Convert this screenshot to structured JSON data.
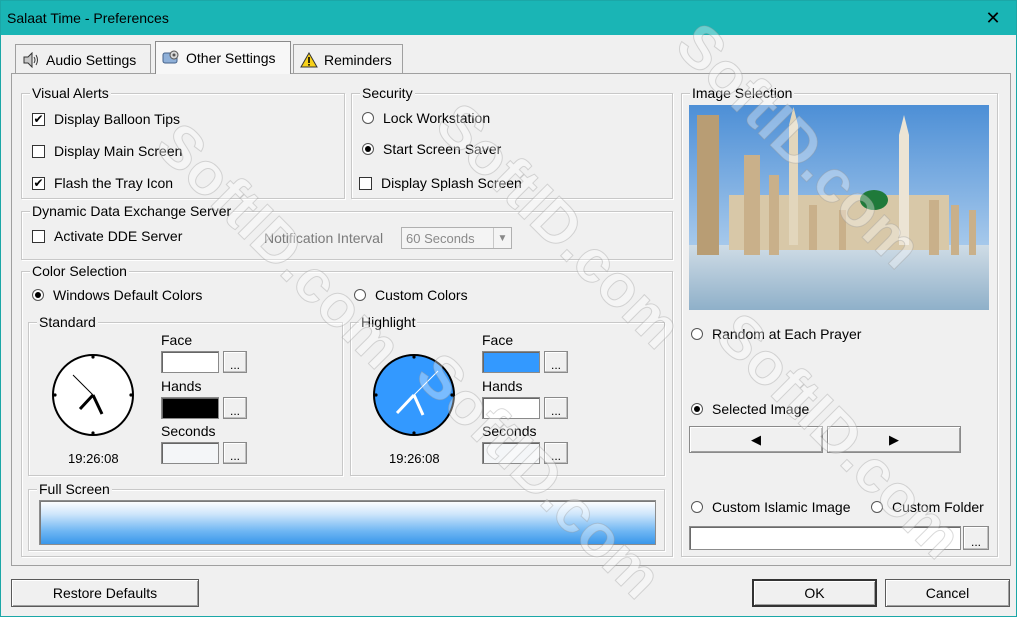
{
  "window": {
    "title": "Salaat Time - Preferences",
    "close_glyph": "✕"
  },
  "tabs": [
    {
      "label": "Audio Settings",
      "icon": "speaker-icon"
    },
    {
      "label": "Other Settings",
      "icon": "gear-icon"
    },
    {
      "label": "Reminders",
      "icon": "warning-icon"
    }
  ],
  "visual_alerts": {
    "title": "Visual Alerts",
    "items": [
      {
        "label": "Display Balloon Tips",
        "checked": true
      },
      {
        "label": "Display Main Screen",
        "checked": false
      },
      {
        "label": "Flash the Tray Icon",
        "checked": true
      }
    ]
  },
  "security": {
    "title": "Security",
    "lock": {
      "label": "Lock Workstation",
      "selected": false
    },
    "saver": {
      "label": "Start Screen Saver",
      "selected": true
    },
    "splash": {
      "label": "Display Splash Screen",
      "checked": false
    }
  },
  "dde": {
    "title": "Dynamic Data Exchange Server",
    "activate": {
      "label": "Activate DDE Server",
      "checked": false
    },
    "interval_label": "Notification Interval",
    "interval_value": "60 Seconds"
  },
  "color_selection": {
    "title": "Color Selection",
    "default_option": {
      "label": "Windows Default Colors",
      "selected": true
    },
    "custom_option": {
      "label": "Custom Colors",
      "selected": false
    },
    "standard": {
      "title": "Standard",
      "time": "19:26:08",
      "face_label": "Face",
      "hands_label": "Hands",
      "seconds_label": "Seconds",
      "face_color": "#ffffff",
      "hands_color": "#000000",
      "seconds_color": "#f4f6f8",
      "clock_face": "#ffffff",
      "clock_hands": "#000000"
    },
    "highlight": {
      "title": "Highlight",
      "time": "19:26:08",
      "face_label": "Face",
      "hands_label": "Hands",
      "seconds_label": "Seconds",
      "face_color": "#3399ff",
      "hands_color": "#ffffff",
      "seconds_color": "#f4f6f8",
      "clock_face": "#3399ff",
      "clock_hands": "#ffffff"
    },
    "ellipsis": "..."
  },
  "full_screen": {
    "title": "Full Screen"
  },
  "image_selection": {
    "title": "Image Selection",
    "random": {
      "label": "Random at Each Prayer",
      "selected": false
    },
    "selected": {
      "label": "Selected Image",
      "selected": true
    },
    "prev_glyph": "◀",
    "next_glyph": "▶",
    "custom_islamic": {
      "label": "Custom Islamic Image",
      "selected": false
    },
    "custom_folder": {
      "label": "Custom Folder",
      "selected": false
    },
    "folder_value": "",
    "ellipsis": "..."
  },
  "buttons": {
    "restore": "Restore Defaults",
    "ok": "OK",
    "cancel": "Cancel"
  },
  "watermark_text": "SoftID.com",
  "colors": {
    "titlebar": "#1ab5b5",
    "accent": "#3399ff"
  }
}
